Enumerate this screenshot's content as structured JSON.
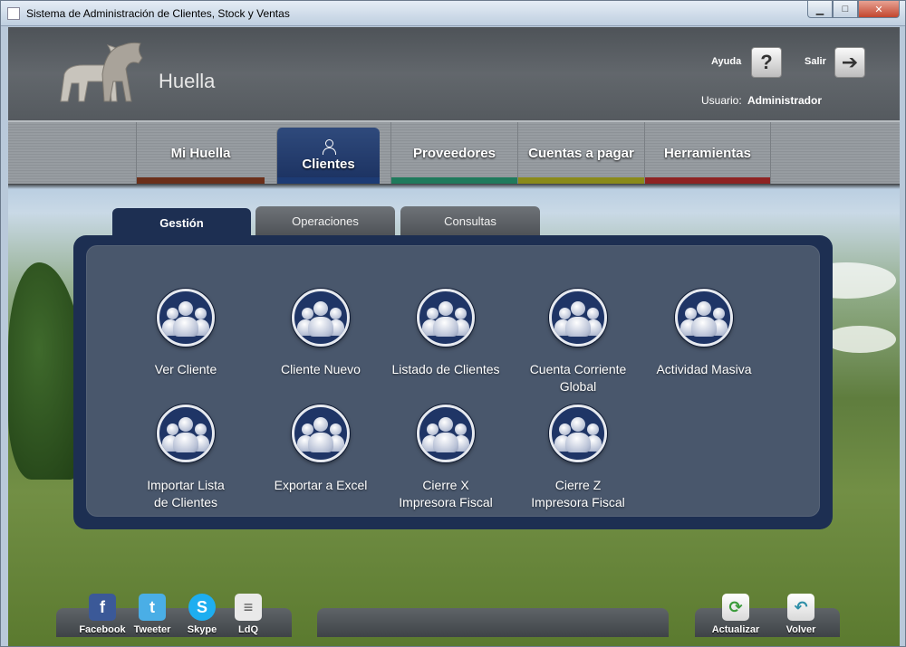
{
  "window": {
    "title": "Sistema de Administración de Clientes, Stock y Ventas",
    "buttons": {
      "minimize": "▁",
      "maximize": "□",
      "close": "✕"
    }
  },
  "header": {
    "brand": "Huella",
    "help_label": "Ayuda",
    "help_glyph": "?",
    "exit_label": "Salir",
    "exit_glyph": "➔",
    "user_label": "Usuario:",
    "user_value": "Administrador"
  },
  "nav": [
    {
      "label": "Mi Huella",
      "color": "#6b2f1a"
    },
    {
      "label": "Clientes",
      "color": "#1d3b74",
      "active": true
    },
    {
      "label": "Proveedores",
      "color": "#1f7a5c"
    },
    {
      "label": "Cuentas a pagar",
      "color": "#8a8a1a"
    },
    {
      "label": "Herramientas",
      "color": "#8e2323"
    }
  ],
  "tabs": [
    {
      "label": "Gestión",
      "active": true
    },
    {
      "label": "Operaciones"
    },
    {
      "label": "Consultas"
    }
  ],
  "actions": [
    {
      "label": "Ver Cliente",
      "icon": "users-group-icon"
    },
    {
      "label": "Cliente Nuevo",
      "icon": "users-group-icon"
    },
    {
      "label": "Listado de Clientes",
      "icon": "users-group-icon"
    },
    {
      "label": "Cuenta Corriente Global",
      "icon": "users-group-icon"
    },
    {
      "label": "Actividad Masiva",
      "icon": "users-group-icon"
    },
    {
      "label": "Importar Lista de Clientes",
      "icon": "users-group-icon"
    },
    {
      "label": "Exportar a Excel",
      "icon": "users-group-icon"
    },
    {
      "label": "Cierre X Impresora Fiscal",
      "icon": "users-group-icon"
    },
    {
      "label": "Cierre Z Impresora Fiscal",
      "icon": "users-group-icon"
    }
  ],
  "footer": {
    "social": [
      {
        "label": "Facebook",
        "glyph": "f",
        "icon": "facebook-icon",
        "color": "#3b5998"
      },
      {
        "label": "Tweeter",
        "glyph": "t",
        "icon": "twitter-icon",
        "color": "#4aaee6"
      },
      {
        "label": "Skype",
        "glyph": "S",
        "icon": "skype-icon",
        "color": "#1eaef0"
      },
      {
        "label": "LdQ",
        "glyph": "≡",
        "icon": "ldq-icon",
        "color": "#e9e9e9"
      }
    ],
    "refresh_label": "Actualizar",
    "refresh_glyph": "⟳",
    "back_label": "Volver",
    "back_glyph": "↶"
  }
}
